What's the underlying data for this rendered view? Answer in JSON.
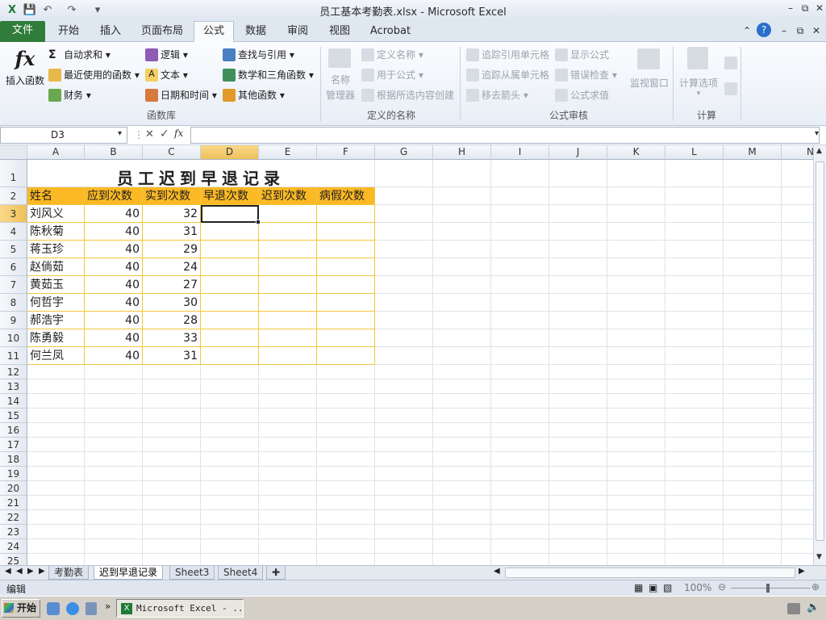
{
  "window": {
    "title": "员工基本考勤表.xlsx - Microsoft Excel",
    "quick_access": {
      "undo_icon": "undo-icon",
      "redo_icon": "redo-icon",
      "save_icon": "save-icon"
    }
  },
  "tabs": [
    {
      "label": "文件"
    },
    {
      "label": "开始"
    },
    {
      "label": "插入"
    },
    {
      "label": "页面布局"
    },
    {
      "label": "公式"
    },
    {
      "label": "数据"
    },
    {
      "label": "审阅"
    },
    {
      "label": "视图"
    },
    {
      "label": "Acrobat"
    }
  ],
  "ribbon": {
    "insert_function": "插入函数",
    "autosum": "自动求和",
    "recent": "最近使用的函数",
    "finance": "财务",
    "logic": "逻辑",
    "text": "文本",
    "datetime": "日期和时间",
    "lookup": "查找与引用",
    "math": "数学和三角函数",
    "other": "其他函数",
    "group_library": "函数库",
    "name_manager_1": "名称",
    "name_manager_2": "管理器",
    "define_name": "定义名称",
    "use_in_formula": "用于公式",
    "create_from_sel": "根据所选内容创建",
    "group_names": "定义的名称",
    "trace_precedents": "追踪引用单元格",
    "trace_dependents": "追踪从属单元格",
    "remove_arrows": "移去箭头",
    "show_formulas": "显示公式",
    "error_checking": "错误检查",
    "evaluate": "公式求值",
    "watch_window": "监视窗口",
    "group_audit": "公式审核",
    "calc_options": "计算选项",
    "group_calc": "计算"
  },
  "formula_bar": {
    "name_box": "D3",
    "formula": ""
  },
  "columns": [
    "A",
    "B",
    "C",
    "D",
    "E",
    "F",
    "G",
    "H",
    "I",
    "J",
    "K",
    "L",
    "M",
    "N"
  ],
  "sheet": {
    "title": "员工迟到早退记录",
    "headers": [
      "姓名",
      "应到次数",
      "实到次数",
      "早退次数",
      "迟到次数",
      "病假次数"
    ],
    "rows": [
      {
        "name": "刘风义",
        "due": 40,
        "actual": 32
      },
      {
        "name": "陈秋菊",
        "due": 40,
        "actual": 31
      },
      {
        "name": "蒋玉珍",
        "due": 40,
        "actual": 29
      },
      {
        "name": "赵倘茹",
        "due": 40,
        "actual": 24
      },
      {
        "name": "黄茹玉",
        "due": 40,
        "actual": 27
      },
      {
        "name": "何哲宇",
        "due": 40,
        "actual": 30
      },
      {
        "name": "郝浩宇",
        "due": 40,
        "actual": 28
      },
      {
        "name": "陈勇毅",
        "due": 40,
        "actual": 33
      },
      {
        "name": "何兰凤",
        "due": 40,
        "actual": 31
      }
    ],
    "selected_cell": "D3"
  },
  "sheet_tabs": [
    "考勤表",
    "迟到早退记录",
    "Sheet3",
    "Sheet4"
  ],
  "active_sheet": "迟到早退记录",
  "status": {
    "mode": "编辑",
    "zoom": "100%"
  },
  "taskbar": {
    "start": "开始",
    "app": "Microsoft Excel - ..."
  }
}
